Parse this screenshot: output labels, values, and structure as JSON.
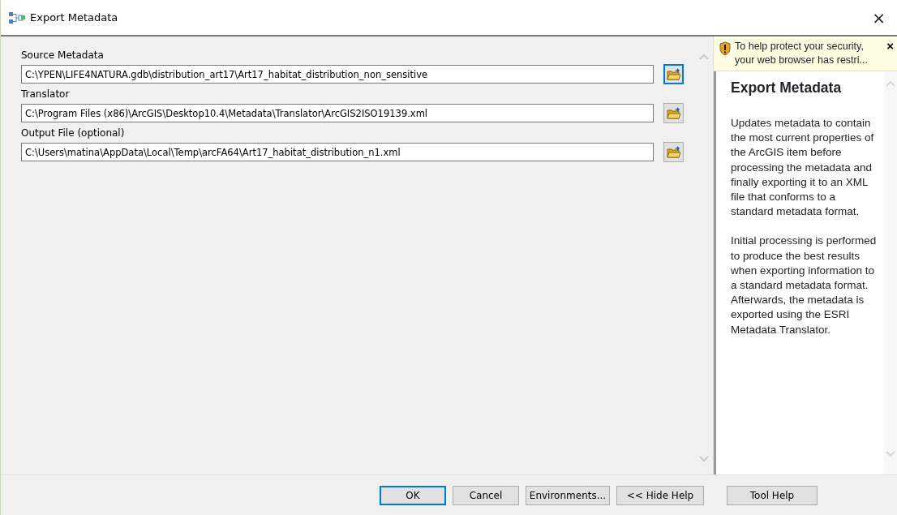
{
  "window": {
    "title": "Export Metadata",
    "close": "×"
  },
  "parameters": [
    {
      "label": "Source Metadata",
      "value": "C:\\YPEN\\LIFE4NATURA.gdb\\distribution_art17\\Art17_habitat_distribution_non_sensitive",
      "browse_focused": true
    },
    {
      "label": "Translator",
      "value": "C:\\Program Files (x86)\\ArcGIS\\Desktop10.4\\Metadata\\Translator\\ArcGIS2ISO19139.xml",
      "browse_focused": false
    },
    {
      "label": "Output File (optional)",
      "value": "C:\\Users\\matina\\AppData\\Local\\Temp\\arcFA64\\Art17_habitat_distribution_n1.xml",
      "browse_focused": false
    }
  ],
  "help": {
    "notice": "To help protect your security, your web browser has restri...",
    "notice_close": "×",
    "title": "Export Metadata",
    "paragraphs": [
      "Updates metadata to contain the most current properties of the ArcGIS item before processing the metadata and finally exporting it to an XML file that conforms to a standard metadata format.",
      "Initial processing is performed to produce the best results when exporting information to a standard metadata format. Afterwards, the metadata is exported using the ESRI Metadata Translator."
    ]
  },
  "buttons": [
    {
      "label": "OK",
      "focused": true
    },
    {
      "label": "Cancel",
      "focused": false
    },
    {
      "label": "Environments...",
      "focused": false
    },
    {
      "label": "<< Hide Help",
      "focused": false
    },
    {
      "label": "Tool Help",
      "focused": false
    }
  ]
}
